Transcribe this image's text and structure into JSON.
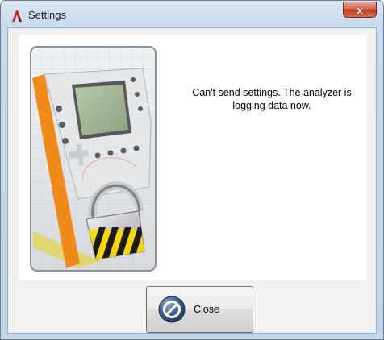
{
  "window": {
    "title": "Settings",
    "close_glyph": "x"
  },
  "icons": {
    "app": "app-logo-icon",
    "close": "close-icon",
    "button": "prohibited-icon",
    "illustration": "locked-analyzer-illustration"
  },
  "message": "Can't send settings. The analyzer is logging data now.",
  "buttons": {
    "close_label": "Close"
  },
  "colors": {
    "accent_orange": "#f08a1a",
    "client_bg": "#f0f0f0",
    "title_close_red": "#c2391d"
  }
}
